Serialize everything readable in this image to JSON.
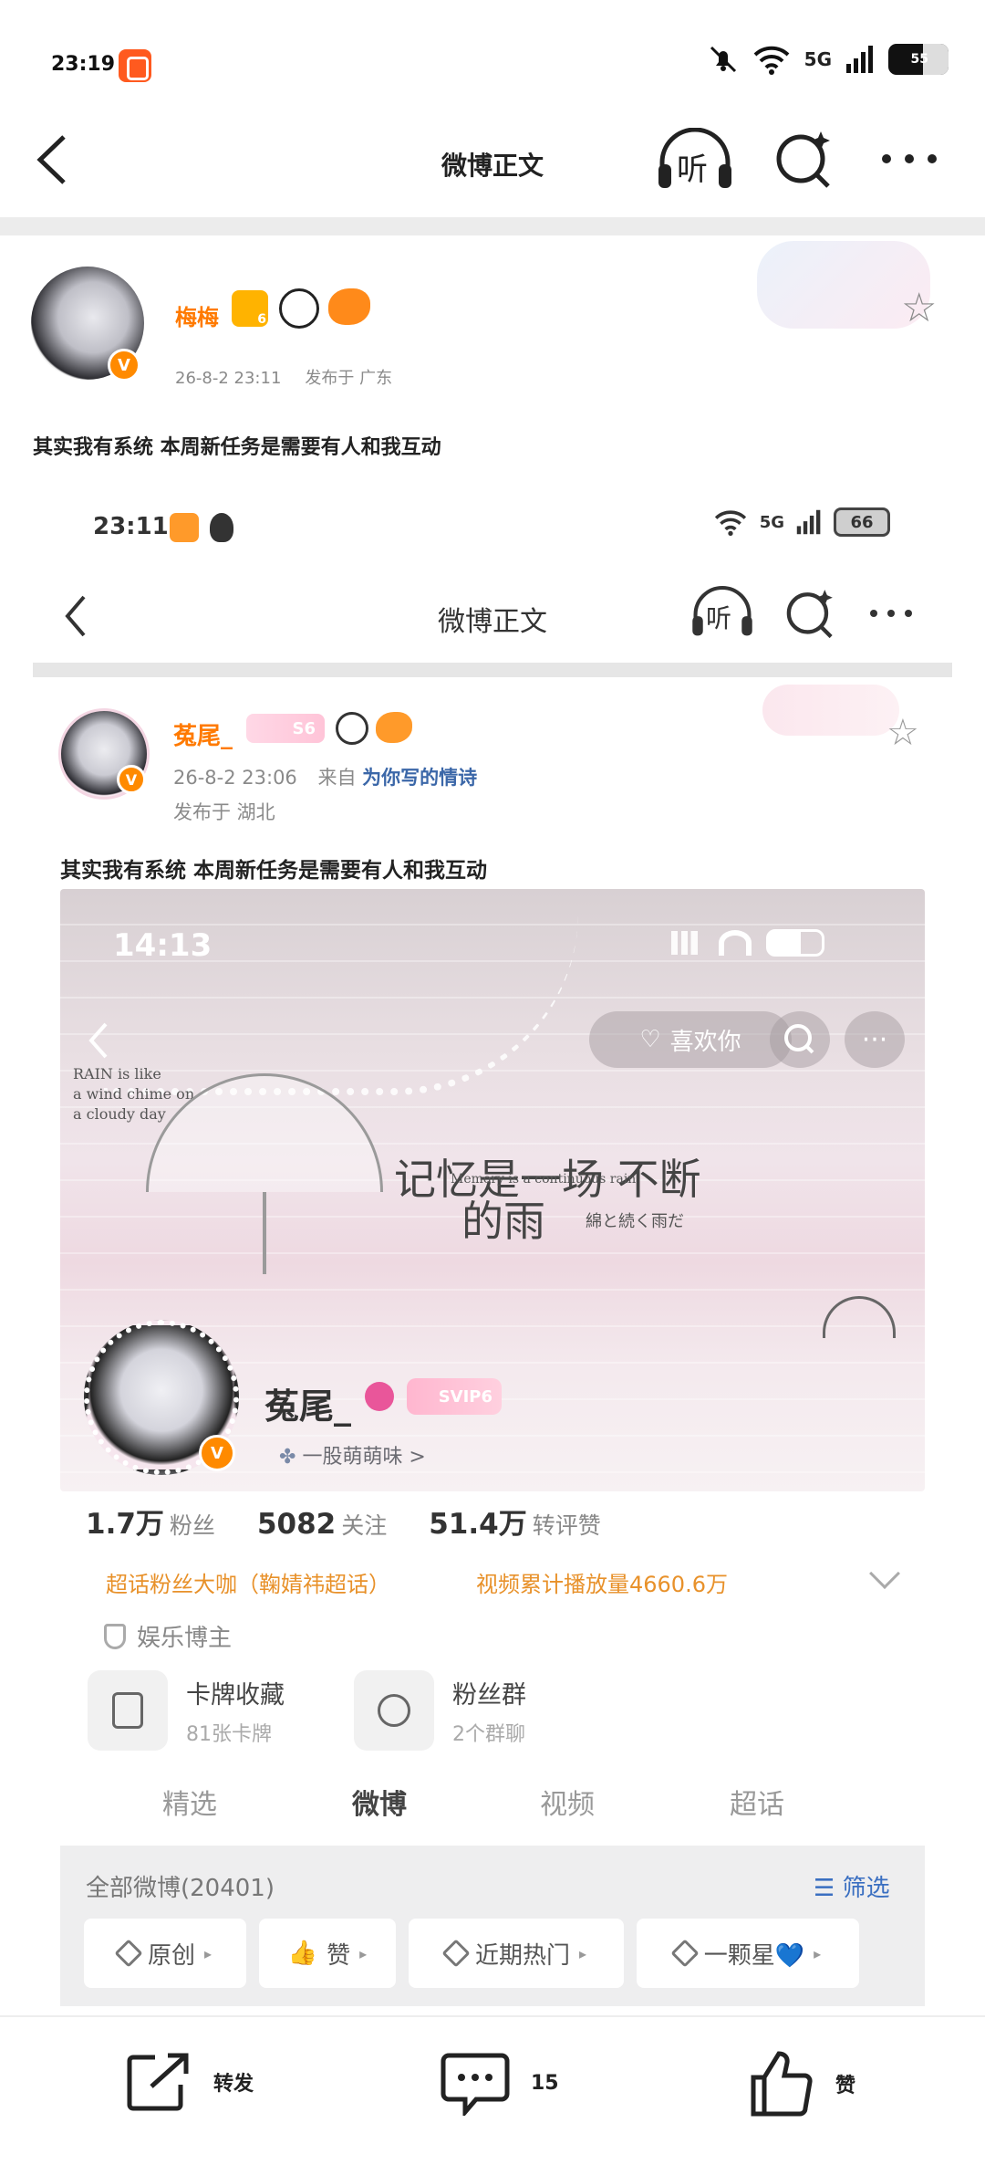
{
  "status_bar": {
    "time": "23:19",
    "network": "5G",
    "battery": "55"
  },
  "nav": {
    "title": "微博正文",
    "listen_label": "听"
  },
  "post": {
    "author": "梅梅",
    "crown_level": "6",
    "date": "26-8-2 23:11",
    "location": "发布于 广东",
    "text": "其实我有系统 本周新任务是需要有人和我互动"
  },
  "embedded": {
    "status_time": "23:11",
    "network": "5G",
    "battery": "66",
    "nav_title": "微博正文",
    "listen_label": "听",
    "author": "菟尾_",
    "badge": "S6",
    "date": "26-8-2 23:06",
    "source_prefix": "来自",
    "source": "为你写的情诗",
    "location": "发布于 湖北",
    "text": "其实我有系统 本周新任务是需要有人和我互动",
    "profile": {
      "status_time": "14:13",
      "like_button": "喜欢你",
      "rain_caption": [
        "RAIN is like",
        "a wind chime on",
        "a cloudy day"
      ],
      "slogan_line1": "记忆是一场 不断",
      "slogan_en": "Memory is a continuous rain",
      "slogan_line2": "的雨",
      "slogan_jp": "綿と続く雨だ",
      "name": "菟尾_",
      "svip": "SVIP6",
      "mood": "一股萌萌味 >",
      "stats": [
        {
          "value": "1.7万",
          "label": "粉丝"
        },
        {
          "value": "5082",
          "label": "关注"
        },
        {
          "value": "51.4万",
          "label": "转评赞"
        }
      ],
      "fan_title": "超话粉丝大咖（鞠婧祎超话）",
      "play_count": "视频累计播放量4660.6万",
      "category": "娱乐博主",
      "cards": [
        {
          "title": "卡牌收藏",
          "sub": "81张卡牌"
        },
        {
          "title": "粉丝群",
          "sub": "2个群聊"
        }
      ],
      "tabs": [
        "精选",
        "微博",
        "视频",
        "超话"
      ],
      "all_posts": "全部微博(20401)",
      "filter": "筛选",
      "chips": [
        "原创",
        "赞",
        "近期热门",
        "一颗星💙"
      ]
    }
  },
  "actions": {
    "repost": "转发",
    "comments": "15",
    "like": "赞"
  },
  "colors": {
    "accent": "#ff7a00",
    "link": "#3b67a8",
    "filter_blue": "#3a6fc1",
    "fan_orange": "#e8912a"
  }
}
